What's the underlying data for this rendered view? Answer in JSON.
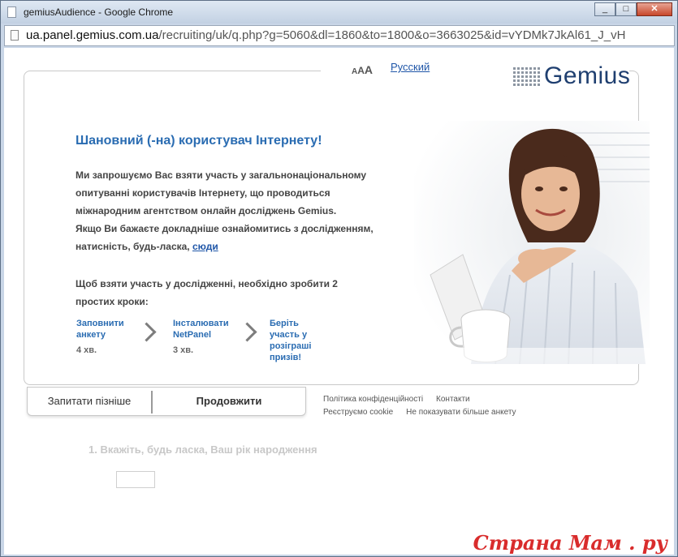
{
  "window": {
    "title": "gemiusAudience - Google Chrome",
    "url_host": "ua.panel.gemius.com.ua",
    "url_path": "/recruiting/uk/q.php?g=5060&dl=1860&to=1800&o=3663025&id=vYDMk7JkAl61_J_vH"
  },
  "header": {
    "font_size_label_small": "A",
    "font_size_label_medium": "A",
    "font_size_label_large": "A",
    "language_link": "Русский",
    "logo_text": "Gemius"
  },
  "main": {
    "heading": "Шановний (-на) користувач Інтернету!",
    "intro_line1": "Ми запрошуємо Вас взяти участь у загальнонаціональному",
    "intro_line2": "опитуванні користувачів Інтернету, що проводиться",
    "intro_line3": "міжнародним агентством онлайн досліджень Gemius.",
    "intro_line4": "Якщо Ви бажаєте докладніше ознайомитись з дослідженням,",
    "intro_line5_prefix": "натисність, будь-ласка, ",
    "intro_link": "сюди",
    "steps_intro_line1": "Щоб взяти участь у дослідженні, необхідно зробити 2",
    "steps_intro_line2": "простих кроки:",
    "steps": [
      {
        "line1": "Заповнити",
        "line2": "анкету",
        "time": "4 хв."
      },
      {
        "line1": "Інсталювати",
        "line2": "NetPanel",
        "time": "3 хв."
      },
      {
        "line1": "Беріть",
        "line2": "участь у",
        "line3": "розіграші",
        "line4": "призів!"
      }
    ]
  },
  "buttons": {
    "later": "Запитати пізніше",
    "continue": "Продовжити"
  },
  "footer_links": {
    "privacy": "Політика конфіденційності",
    "contacts": "Контакти",
    "cookie": "Реєструємо cookie",
    "hide": "Не показувати більше анкету"
  },
  "question": {
    "text": "1. Вкажіть, будь ласка, Ваш рік народження",
    "value": ""
  },
  "watermark": "Страна Мам . ру",
  "colors": {
    "accent": "#2a6cb2",
    "link": "#1f56a8",
    "logo": "#1f3f70"
  }
}
